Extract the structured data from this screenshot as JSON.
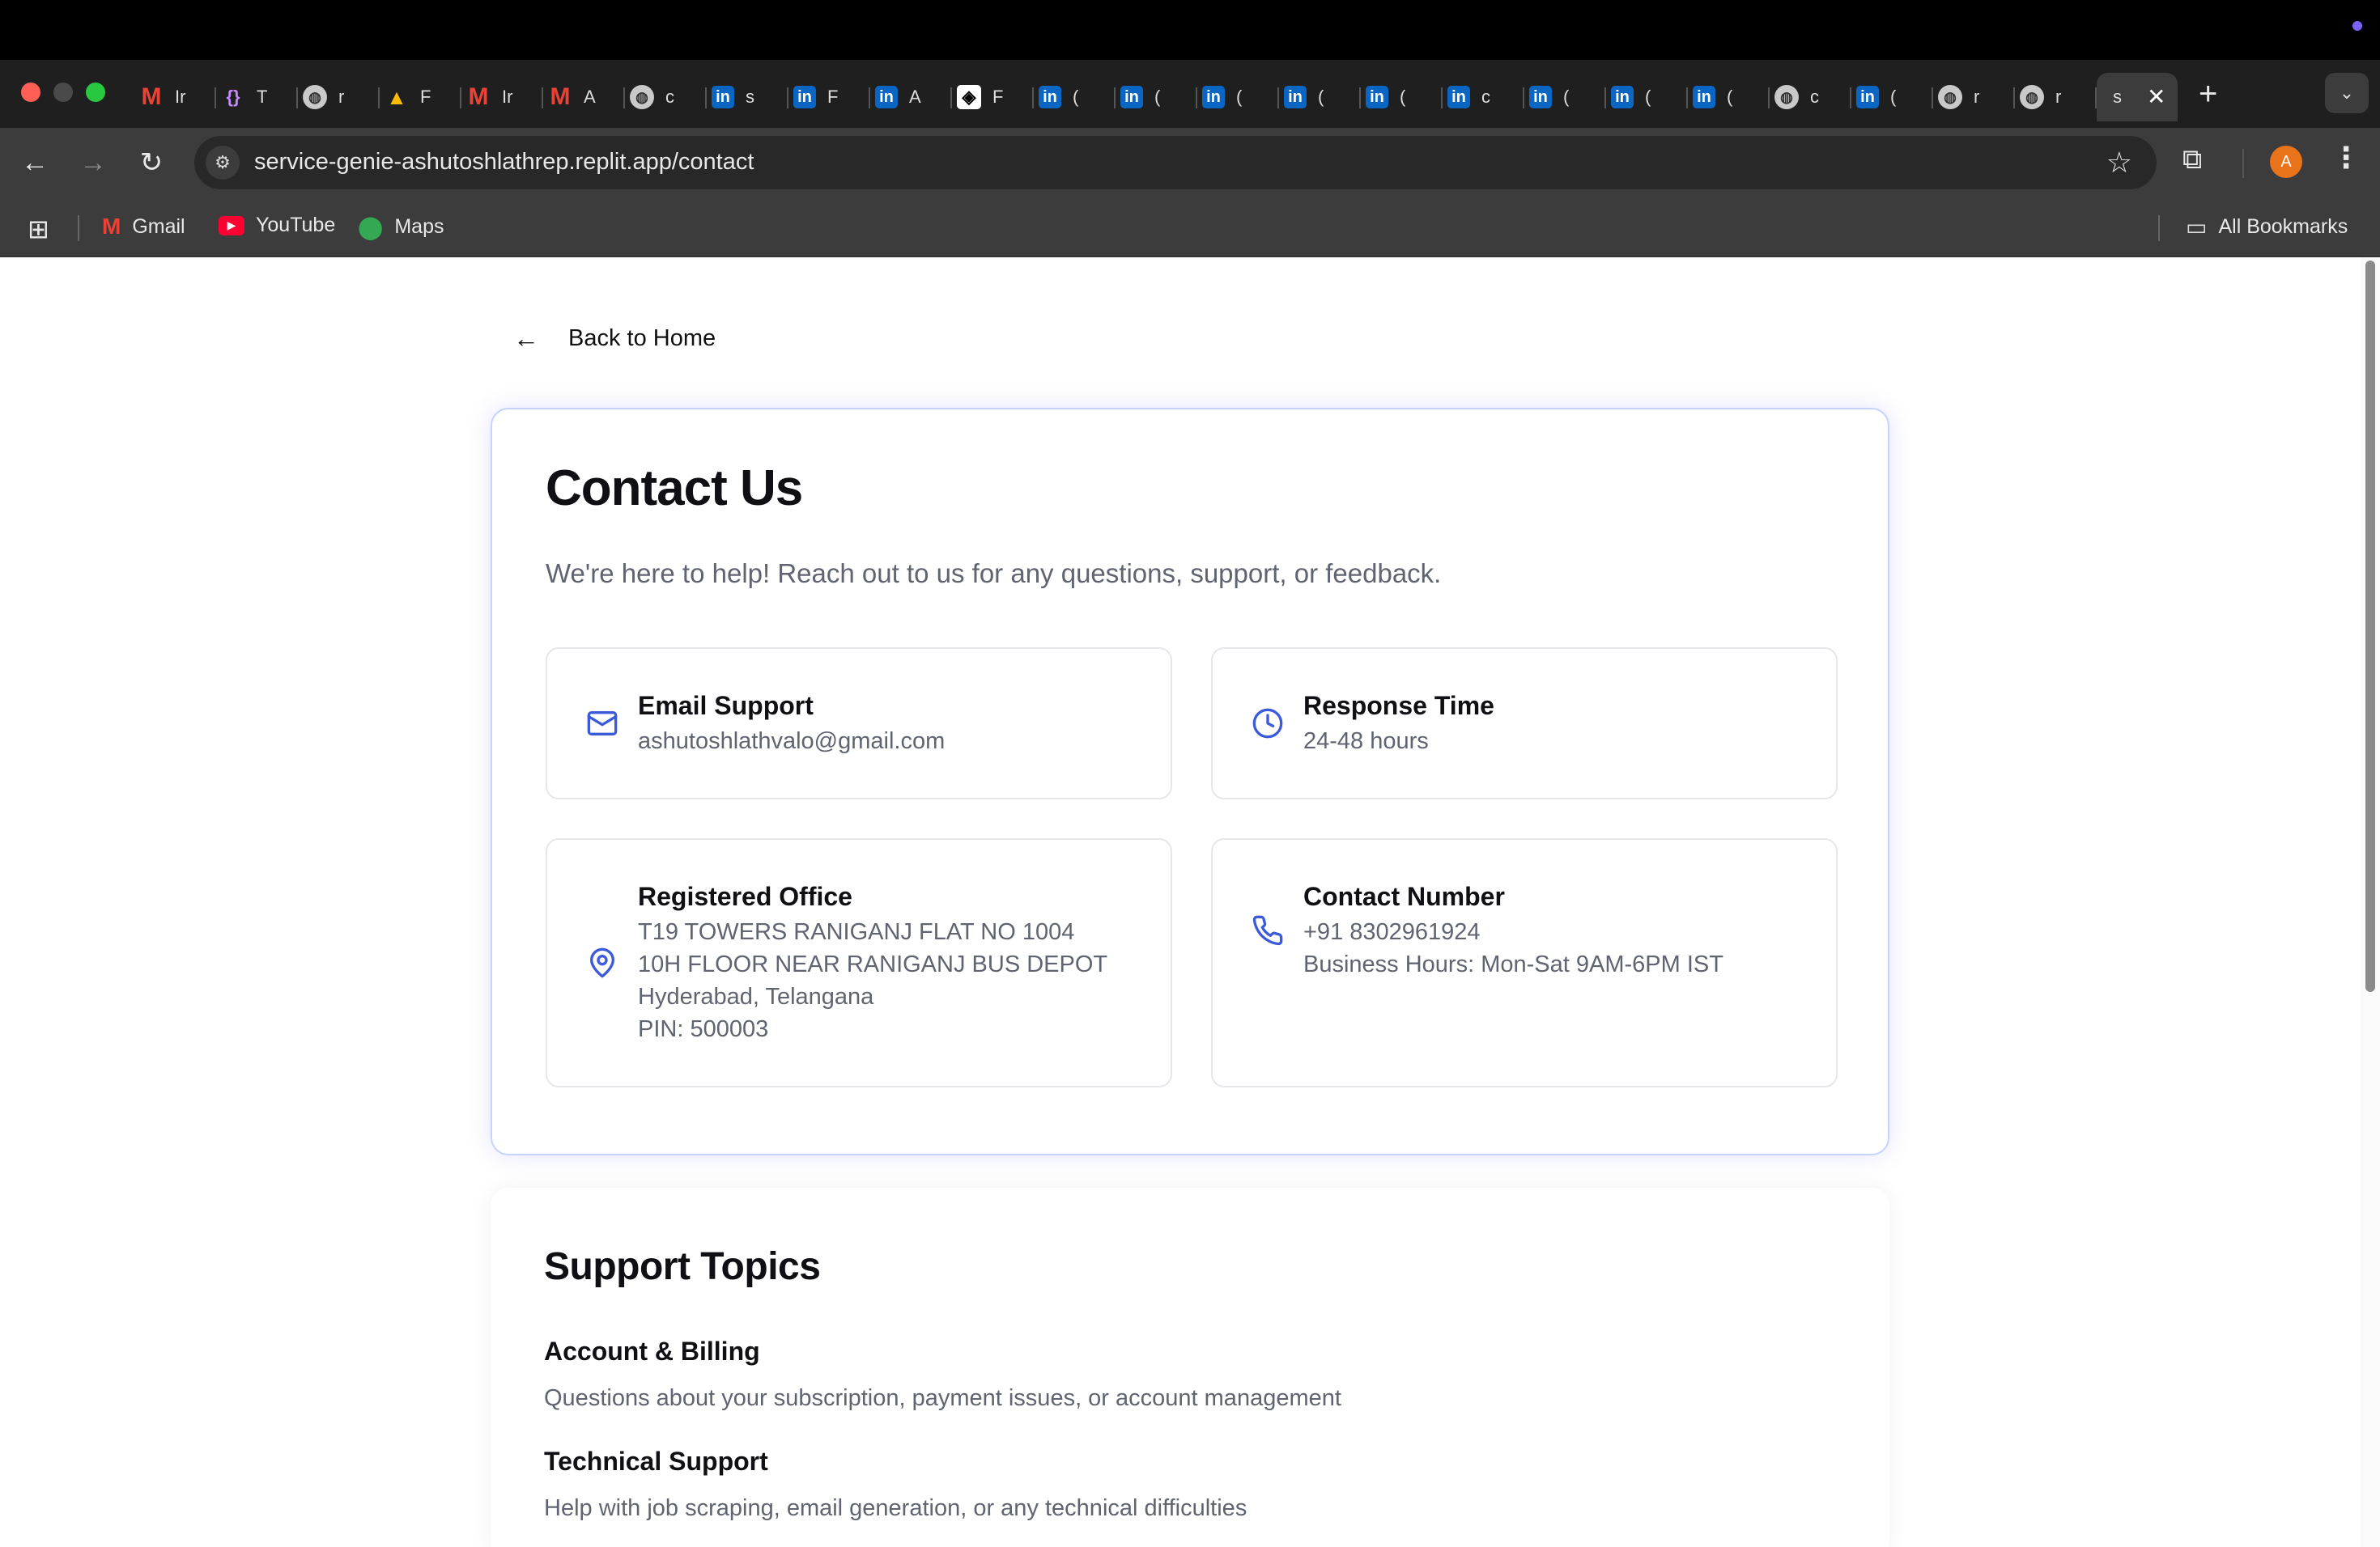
{
  "browser": {
    "tabs": [
      {
        "icon": "gmail-icon",
        "title": "Ir"
      },
      {
        "icon": "code-icon",
        "title": "T"
      },
      {
        "icon": "globe-icon",
        "title": "r"
      },
      {
        "icon": "drive-icon",
        "title": "F"
      },
      {
        "icon": "gmail-icon",
        "title": "Ir"
      },
      {
        "icon": "gmail-icon",
        "title": "A"
      },
      {
        "icon": "globe-icon",
        "title": "c"
      },
      {
        "icon": "linkedin-icon",
        "title": "s"
      },
      {
        "icon": "linkedin-icon",
        "title": "F"
      },
      {
        "icon": "linkedin-icon",
        "title": "A"
      },
      {
        "icon": "notion-icon",
        "title": "F"
      },
      {
        "icon": "linkedin-icon",
        "title": "("
      },
      {
        "icon": "linkedin-icon",
        "title": "("
      },
      {
        "icon": "linkedin-icon",
        "title": "("
      },
      {
        "icon": "linkedin-icon",
        "title": "("
      },
      {
        "icon": "linkedin-icon",
        "title": "("
      },
      {
        "icon": "linkedin-icon",
        "title": "c"
      },
      {
        "icon": "linkedin-icon",
        "title": "("
      },
      {
        "icon": "linkedin-icon",
        "title": "("
      },
      {
        "icon": "linkedin-icon",
        "title": "("
      },
      {
        "icon": "globe-icon",
        "title": "c"
      },
      {
        "icon": "linkedin-icon",
        "title": "("
      },
      {
        "icon": "globe-icon",
        "title": "r"
      },
      {
        "icon": "globe-icon",
        "title": "r"
      }
    ],
    "active_tab": {
      "title": "s"
    },
    "new_tab": "+",
    "url_host": "service-genie-ashutoshlathrep.replit.app",
    "url_path": "/contact",
    "avatar_letter": "A",
    "bookmarks": {
      "gmail": "Gmail",
      "youtube": "YouTube",
      "maps": "Maps",
      "all": "All Bookmarks"
    }
  },
  "page": {
    "back_link": "Back to Home",
    "contact": {
      "title": "Contact Us",
      "intro": "We're here to help! Reach out to us for any questions, support, or feedback.",
      "email": {
        "title": "Email Support",
        "value": "ashutoshlathvalo@gmail.com"
      },
      "response": {
        "title": "Response Time",
        "value": "24-48 hours"
      },
      "office": {
        "title": "Registered Office",
        "line1": "T19 TOWERS RANIGANJ FLAT NO 1004",
        "line2": "10H FLOOR NEAR RANIGANJ BUS DEPOT",
        "line3": "Hyderabad, Telangana",
        "line4": "PIN: 500003"
      },
      "phone": {
        "title": "Contact Number",
        "number": "+91 8302961924",
        "hours": "Business Hours: Mon-Sat 9AM-6PM IST"
      }
    },
    "support": {
      "title": "Support Topics",
      "topics": [
        {
          "title": "Account & Billing",
          "desc": "Questions about your subscription, payment issues, or account management"
        },
        {
          "title": "Technical Support",
          "desc": "Help with job scraping, email generation, or any technical difficulties"
        }
      ]
    }
  },
  "colors": {
    "accent": "#3b5bdb",
    "card_border": "#c7d2fe",
    "muted_text": "#5f6470"
  }
}
